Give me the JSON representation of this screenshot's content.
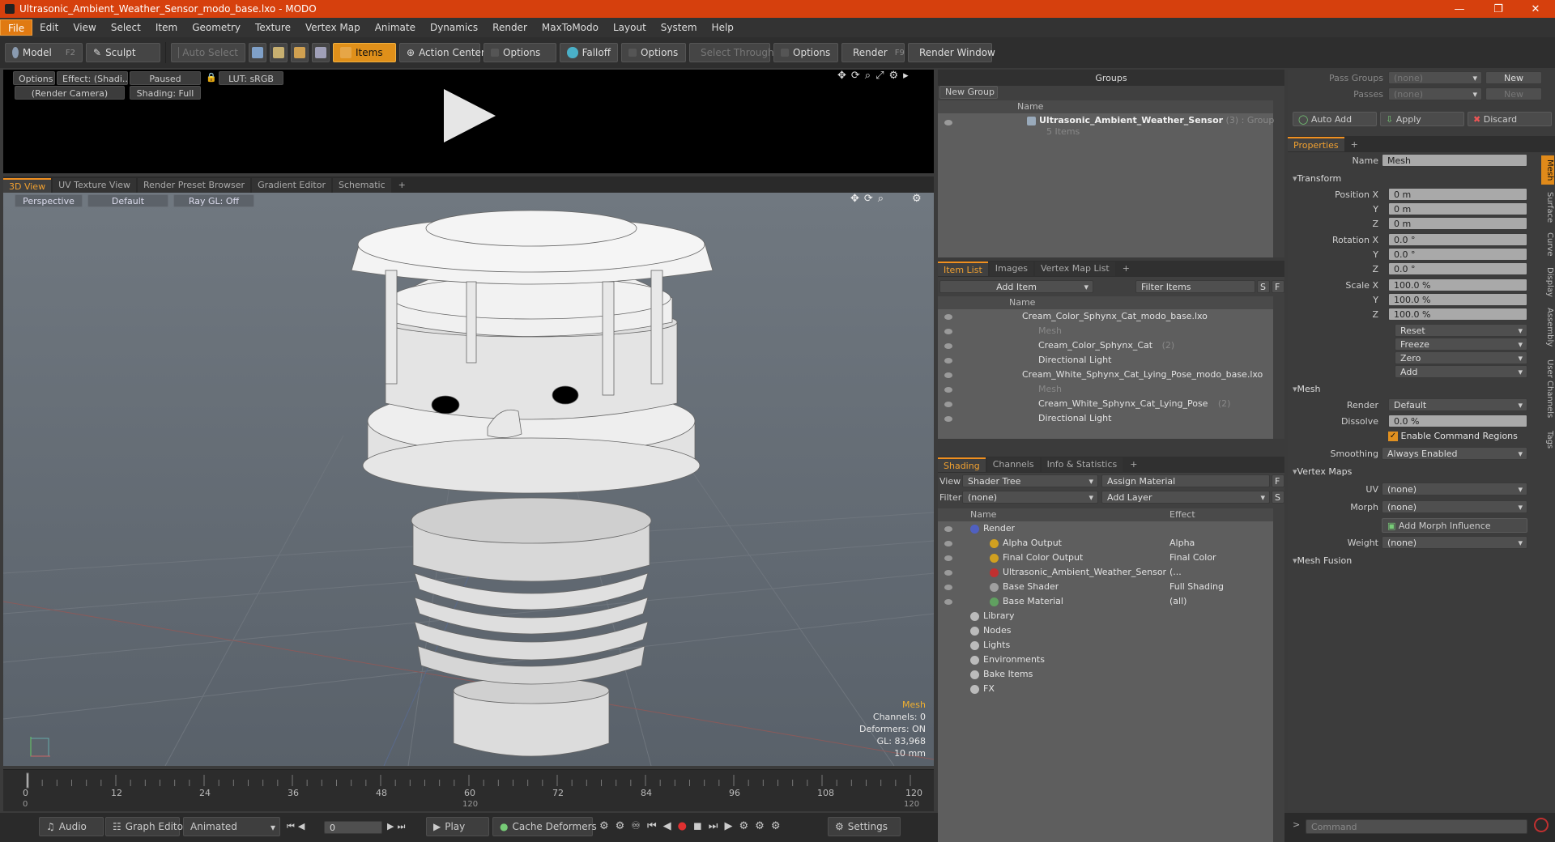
{
  "app": {
    "title": "Ultrasonic_Ambient_Weather_Sensor_modo_base.lxo - MODO",
    "window_controls": [
      "—",
      "❐",
      "✕"
    ]
  },
  "menu": [
    "File",
    "Edit",
    "View",
    "Select",
    "Item",
    "Geometry",
    "Texture",
    "Vertex Map",
    "Animate",
    "Dynamics",
    "Render",
    "MaxToModo",
    "Layout",
    "System",
    "Help"
  ],
  "toolbar": {
    "model": "Model",
    "model_key": "F2",
    "sculpt": "Sculpt",
    "auto_select": "Auto Select",
    "items": "Items",
    "action_center": "Action Center",
    "options1": "Options",
    "falloff": "Falloff",
    "options2": "Options",
    "select_through": "Select Through",
    "options3": "Options",
    "render": "Render",
    "render_key": "F9",
    "render_window": "Render Window"
  },
  "preview": {
    "options": "Options",
    "effect": "Effect: (Shadi...",
    "paused": "Paused",
    "lut": "LUT: sRGB",
    "camera": "(Render Camera)",
    "shading": "Shading: Full"
  },
  "viewport_tabs": [
    "3D View",
    "UV Texture View",
    "Render Preset Browser",
    "Gradient Editor",
    "Schematic",
    "+"
  ],
  "viewport": {
    "perspective": "Perspective",
    "default": "Default",
    "raygl": "Ray GL: Off",
    "info": {
      "type": "Mesh",
      "channels": "Channels: 0",
      "deformers": "Deformers: ON",
      "gl": "GL: 83,968",
      "scale": "10 mm"
    }
  },
  "timeline": {
    "ticks": [
      "0",
      "12",
      "24",
      "36",
      "48",
      "60",
      "72",
      "84",
      "96",
      "108",
      "120"
    ],
    "bottom_ticks": [
      "0",
      "120",
      "120"
    ]
  },
  "bottombar": {
    "audio": "Audio",
    "graph_editor": "Graph Editor",
    "animated": "Animated",
    "frame": "0",
    "play": "Play",
    "cache_deformers": "Cache Deformers",
    "settings": "Settings",
    "command": "Command"
  },
  "groups": {
    "title": "Groups",
    "new_group": "New Group",
    "col_name": "Name",
    "item_name": "Ultrasonic_Ambient_Weather_Sensor",
    "item_count": "(3)",
    "item_type": ": Group",
    "item_sub": "5 Items"
  },
  "itemlist": {
    "tabs": [
      "Item List",
      "Images",
      "Vertex Map List",
      "+"
    ],
    "add_item": "Add Item",
    "filter": "Filter Items",
    "s": "S",
    "f": "F",
    "col_name": "Name",
    "rows": [
      {
        "label": "Cream_Color_Sphynx_Cat_modo_base.lxo",
        "dim": false
      },
      {
        "label": "Mesh",
        "dim": true
      },
      {
        "label": "Cream_Color_Sphynx_Cat",
        "suffix": "(2)",
        "dim": false
      },
      {
        "label": "Directional Light",
        "dim": false
      },
      {
        "label": "Cream_White_Sphynx_Cat_Lying_Pose_modo_base.lxo",
        "dim": false
      },
      {
        "label": "Mesh",
        "dim": true
      },
      {
        "label": "Cream_White_Sphynx_Cat_Lying_Pose",
        "suffix": "(2)",
        "dim": false
      },
      {
        "label": "Directional Light",
        "dim": false
      }
    ]
  },
  "shading": {
    "tabs": [
      "Shading",
      "Channels",
      "Info & Statistics",
      "+"
    ],
    "view_label": "View",
    "view_value": "Shader Tree",
    "assign_material": "Assign Material",
    "f": "F",
    "filter_label": "Filter",
    "filter_value": "(none)",
    "add_layer": "Add Layer",
    "s": "S",
    "col_name": "Name",
    "col_effect": "Effect",
    "rows": [
      {
        "label": "Render",
        "effect": ""
      },
      {
        "label": "Alpha Output",
        "effect": "Alpha"
      },
      {
        "label": "Final Color Output",
        "effect": "Final Color"
      },
      {
        "label": "Ultrasonic_Ambient_Weather_Sensor",
        "effect": "(..."
      },
      {
        "label": "Base Shader",
        "effect": "Full Shading"
      },
      {
        "label": "Base Material",
        "effect": "(all)"
      },
      {
        "label": "Library",
        "effect": ""
      },
      {
        "label": "Nodes",
        "effect": ""
      },
      {
        "label": "Lights",
        "effect": ""
      },
      {
        "label": "Environments",
        "effect": ""
      },
      {
        "label": "Bake Items",
        "effect": ""
      },
      {
        "label": "FX",
        "effect": ""
      }
    ]
  },
  "passgroups": {
    "pass_groups": "Pass Groups",
    "pass_value": "(none)",
    "new": "New",
    "passes": "Passes",
    "passes_value": "(none)",
    "new2": "New",
    "auto_add": "Auto Add",
    "apply": "Apply",
    "discard": "Discard"
  },
  "properties": {
    "title": "Properties",
    "plus": "+",
    "name_label": "Name",
    "name_value": "Mesh",
    "transform": "Transform",
    "position_label": "Position X",
    "pos": [
      "0 m",
      "0 m",
      "0 m"
    ],
    "rotation_label": "Rotation X",
    "rot": [
      "0.0 °",
      "0.0 °",
      "0.0 °"
    ],
    "scale_label": "Scale X",
    "scl": [
      "100.0 %",
      "100.0 %",
      "100.0 %"
    ],
    "y": "Y",
    "z": "Z",
    "actions": [
      "Reset",
      "Freeze",
      "Zero",
      "Add"
    ],
    "mesh": "Mesh",
    "render_label": "Render",
    "render_value": "Default",
    "dissolve_label": "Dissolve",
    "dissolve_value": "0.0 %",
    "enable_cmd": "Enable Command Regions",
    "smoothing_label": "Smoothing",
    "smoothing_value": "Always Enabled",
    "vertex_maps": "Vertex Maps",
    "uv_label": "UV",
    "uv_value": "(none)",
    "morph_label": "Morph",
    "morph_value": "(none)",
    "add_morph": "Add Morph Influence",
    "weight_label": "Weight",
    "weight_value": "(none)",
    "mesh_fusion": "Mesh Fusion",
    "side_tabs": [
      "Mesh",
      "Surface",
      "Curve",
      "Display",
      "Assembly",
      "User Channels",
      "Tags"
    ]
  }
}
